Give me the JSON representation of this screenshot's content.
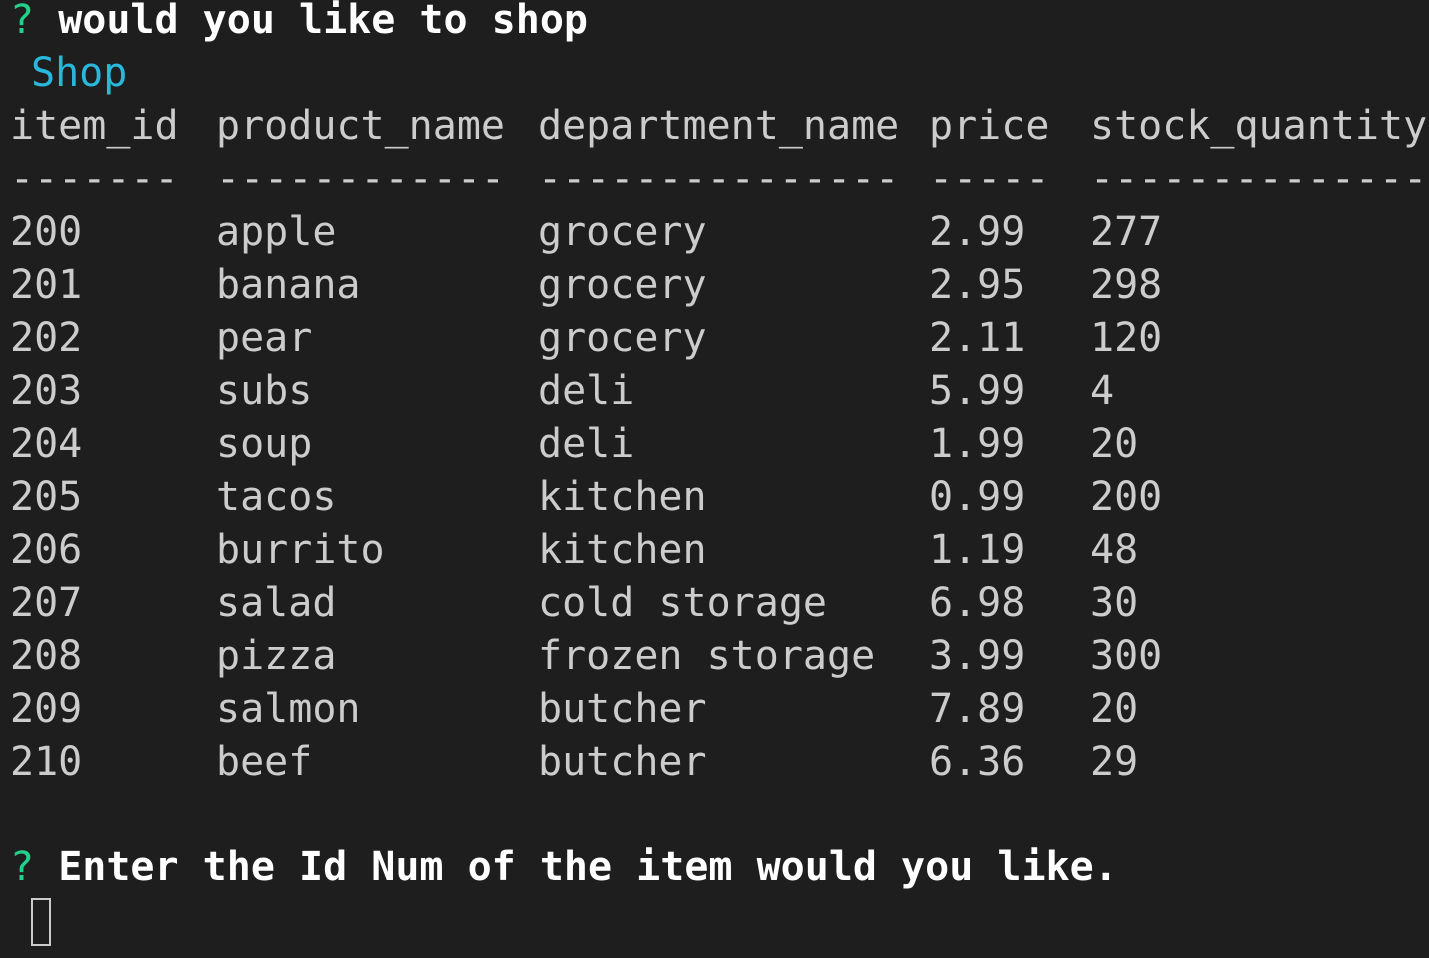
{
  "prompt1": {
    "marker": "?",
    "question": "would you like to shop",
    "answer": "Shop"
  },
  "table": {
    "headers": [
      "item_id",
      "product_name",
      "department_name",
      "price",
      "stock_quantity"
    ],
    "separators": [
      "-------",
      "------------",
      "---------------",
      "-----",
      "--------------"
    ],
    "rows": [
      [
        "200",
        "apple",
        "grocery",
        "2.99",
        "277"
      ],
      [
        "201",
        "banana",
        "grocery",
        "2.95",
        "298"
      ],
      [
        "202",
        "pear",
        "grocery",
        "2.11",
        "120"
      ],
      [
        "203",
        "subs",
        "deli",
        "5.99",
        "4"
      ],
      [
        "204",
        "soup",
        "deli",
        "1.99",
        "20"
      ],
      [
        "205",
        "tacos",
        "kitchen",
        "0.99",
        "200"
      ],
      [
        "206",
        "burrito",
        "kitchen",
        "1.19",
        "48"
      ],
      [
        "207",
        "salad",
        "cold storage",
        "6.98",
        "30"
      ],
      [
        "208",
        "pizza",
        "frozen storage",
        "3.99",
        "300"
      ],
      [
        "209",
        "salmon",
        "butcher",
        "7.89",
        "20"
      ],
      [
        "210",
        "beef",
        "butcher",
        "6.36",
        "29"
      ]
    ]
  },
  "prompt2": {
    "marker": "?",
    "question": "Enter the Id Num of the item would you like.",
    "input_value": ""
  },
  "colors": {
    "background": "#1e1e1e",
    "text": "#cccccc",
    "prompt_marker": "#23d18b",
    "answer": "#29b8db"
  }
}
